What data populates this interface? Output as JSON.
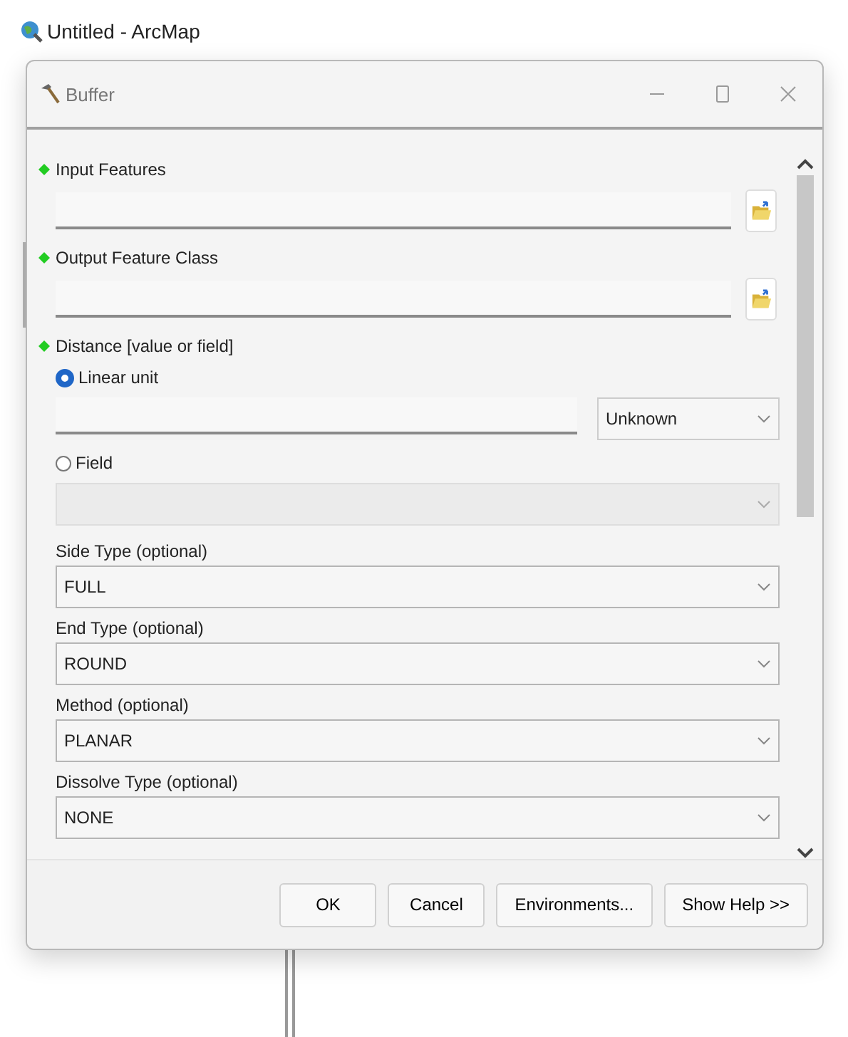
{
  "app": {
    "title": "Untitled - ArcMap"
  },
  "dialog": {
    "title": "Buffer",
    "params": [
      {
        "kind": "path",
        "label": "Input Features",
        "required": true
      },
      {
        "kind": "path",
        "label": "Output Feature Class",
        "required": true
      },
      {
        "kind": "distance",
        "label": "Distance [value or field]",
        "required": true,
        "options": [
          {
            "kind": "unit",
            "label": "Linear unit",
            "selected": true,
            "unit": "Unknown"
          },
          {
            "kind": "field",
            "label": "Field",
            "selected": false
          }
        ]
      },
      {
        "kind": "choice",
        "label": "Side Type (optional)",
        "required": false,
        "value": "FULL"
      },
      {
        "kind": "choice",
        "label": "End Type (optional)",
        "required": false,
        "value": "ROUND"
      },
      {
        "kind": "choice",
        "label": "Method (optional)",
        "required": false,
        "value": "PLANAR"
      },
      {
        "kind": "choice",
        "label": "Dissolve Type (optional)",
        "required": false,
        "value": "NONE"
      }
    ],
    "buttons": [
      {
        "label": "OK"
      },
      {
        "label": "Cancel"
      },
      {
        "label": "Environments..."
      },
      {
        "label": "Show Help >>"
      }
    ]
  }
}
